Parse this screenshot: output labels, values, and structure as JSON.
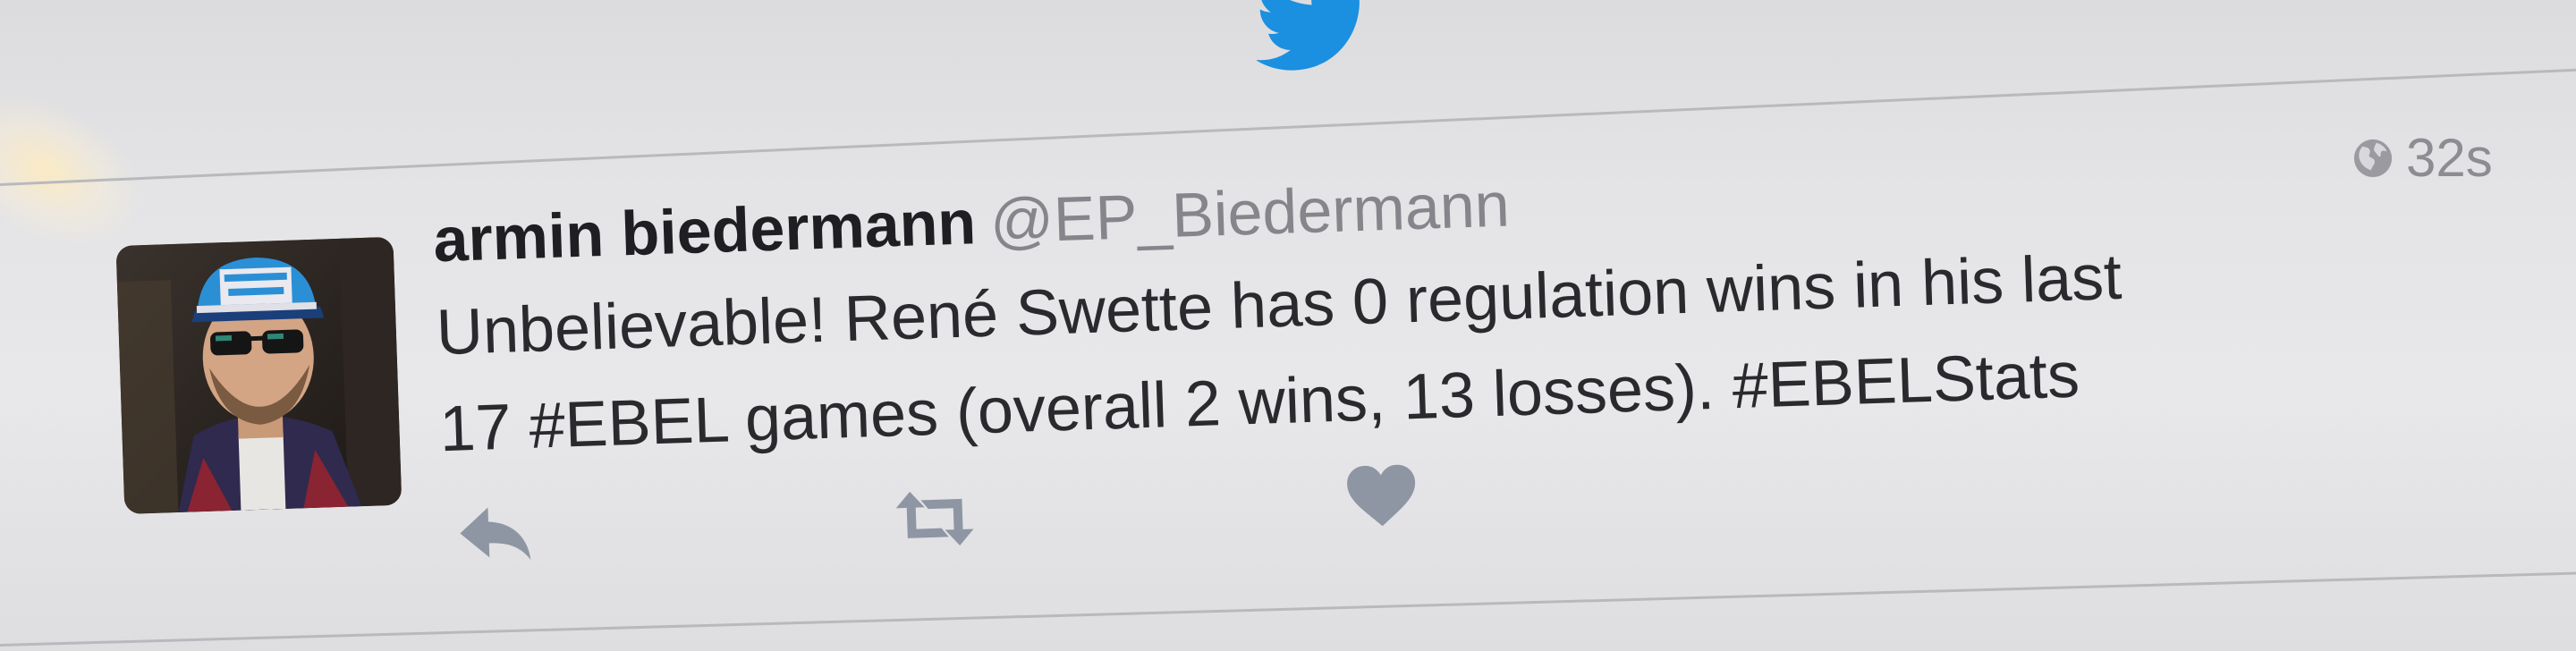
{
  "icons": {
    "top_logo": "bird-icon",
    "visibility": "globe-icon",
    "reply": "reply-icon",
    "retweet": "retweet-icon",
    "like": "heart-icon"
  },
  "colors": {
    "brand": "#1b8fe0",
    "name_text": "#1f1f23",
    "secondary_text": "#85858b",
    "action_icons": "#8e96a4"
  },
  "tweet": {
    "author_name": "armin biedermann",
    "author_handle": "@EP_Biedermann",
    "timestamp": "32s",
    "text_lines": [
      "Unbelievable! René Swette has 0 regulation wins in his last",
      "17 #EBEL games (overall 2 wins, 13 losses). #EBELStats"
    ]
  }
}
